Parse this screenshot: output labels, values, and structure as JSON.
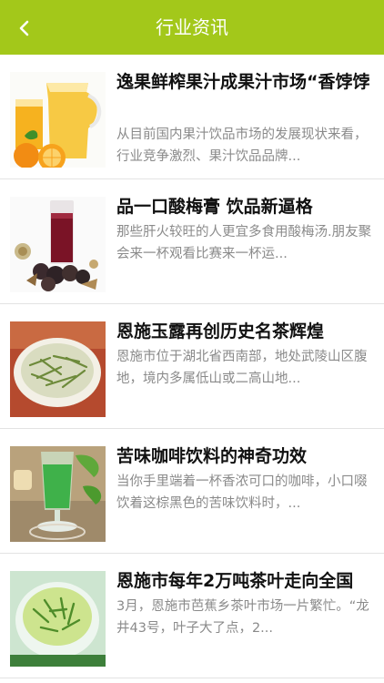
{
  "header": {
    "title": "行业资讯",
    "back_icon": "chevron-left-icon",
    "color": "#a3c81a"
  },
  "articles": [
    {
      "title": "逸果鲜榨果汁成果汁市场“香饽饽",
      "summary": "从目前国内果汁饮品市场的发展现状来看，行业竞争激烈、果汁饮品品牌...",
      "image": "orange-juice"
    },
    {
      "title": "品一口酸梅膏 饮品新逼格",
      "summary": "那些肝火较旺的人更宜多食用酸梅汤.朋友聚会来一杯观看比赛来一杯运...",
      "image": "sour-plum-drink"
    },
    {
      "title": "恩施玉露再创历史名茶辉煌",
      "summary": "恩施市位于湖北省西南部，地处武陵山区腹地，境内多属低山或二高山地...",
      "image": "tea-leaves-bowl"
    },
    {
      "title": "苦味咖啡饮料的神奇功效",
      "summary": "当你手里端着一杯香浓可口的咖啡，小口啜饮着这棕黑色的苦味饮料时，...",
      "image": "green-drink-glass"
    },
    {
      "title": "恩施市每年2万吨茶叶走向全国",
      "summary": "3月，恩施市芭蕉乡茶叶市场一片繁忙。“龙井43号，叶子大了点，2...",
      "image": "green-tea-cup"
    }
  ]
}
